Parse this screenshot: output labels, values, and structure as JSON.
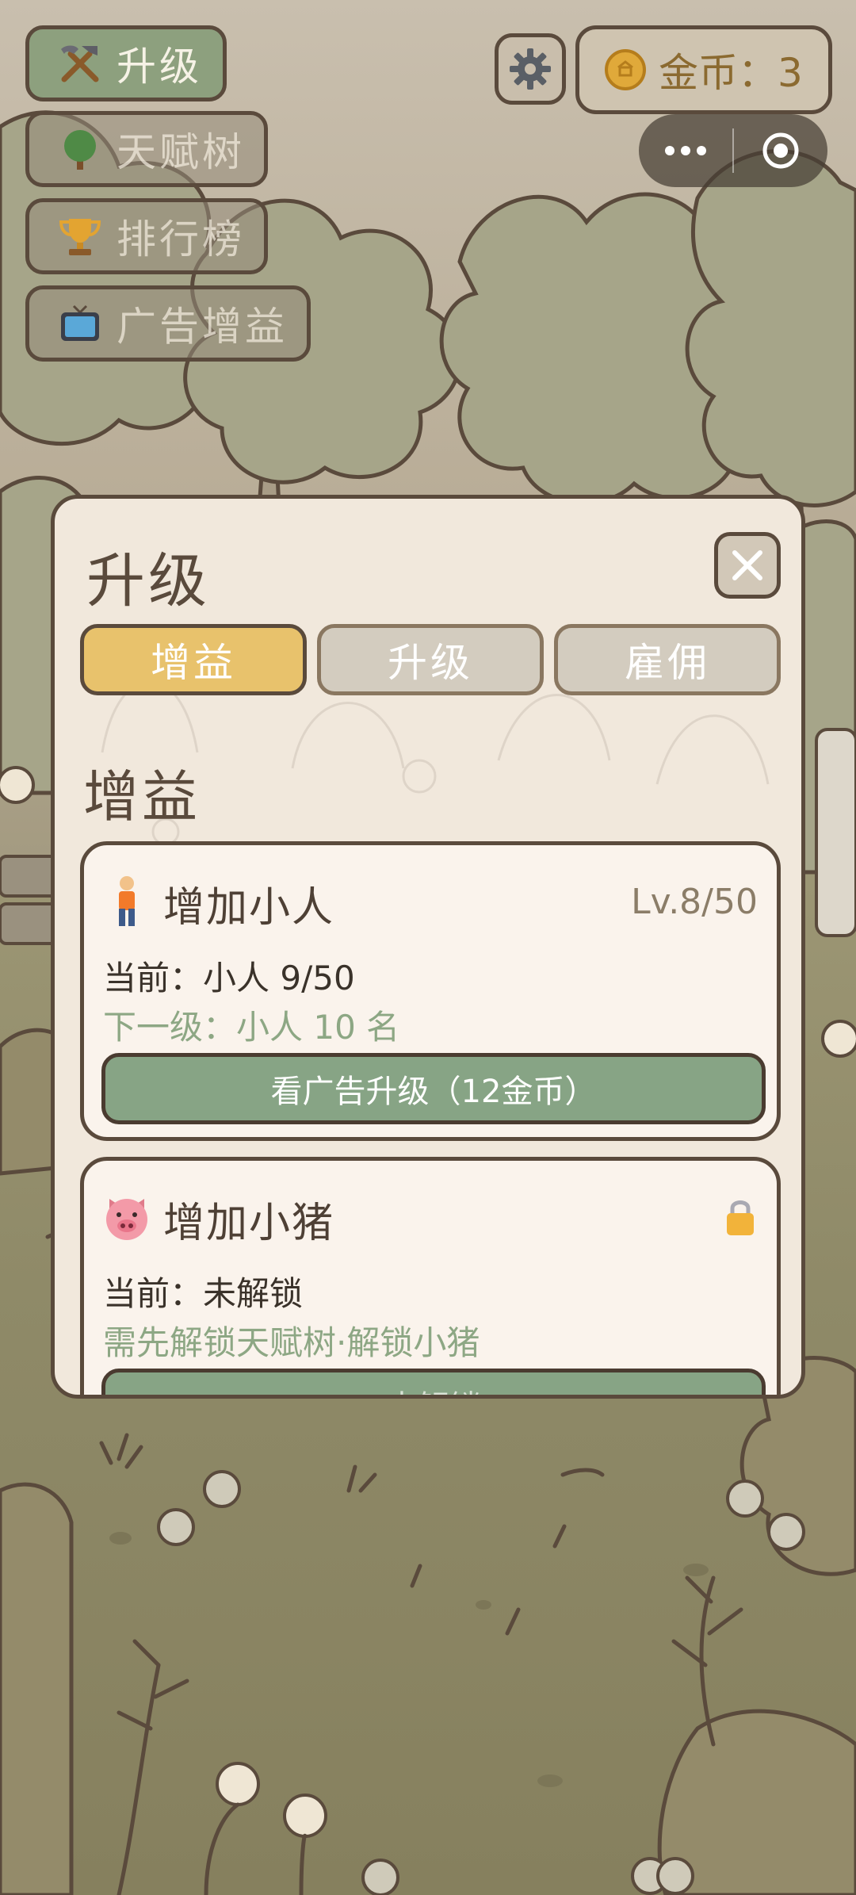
{
  "menu": {
    "upgrade": "升级",
    "talent_tree": "天赋树",
    "leaderboard": "排行榜",
    "ad_bonus": "广告增益"
  },
  "header": {
    "coins_label": "金币：3"
  },
  "modal": {
    "title": "升级",
    "tabs": [
      "增益",
      "升级",
      "雇佣"
    ],
    "section_title": "增益",
    "cards": [
      {
        "title": "增加小人",
        "icon": "person-icon",
        "level": "Lv.8/50",
        "current": "当前：小人 9/50",
        "next": "下一级：小人 10 名",
        "button": "看广告升级（12金币）"
      },
      {
        "title": "增加小猪",
        "icon": "pig-icon",
        "current": "当前：未解锁",
        "next": "需先解锁天赋树·解锁小猪",
        "button": "未解锁",
        "locked": true
      }
    ]
  },
  "colors": {
    "accent_gold": "#e8c26c",
    "button_green": "#87a485",
    "panel_bg": "#f1e8dc",
    "outline": "#5a4a3c"
  }
}
